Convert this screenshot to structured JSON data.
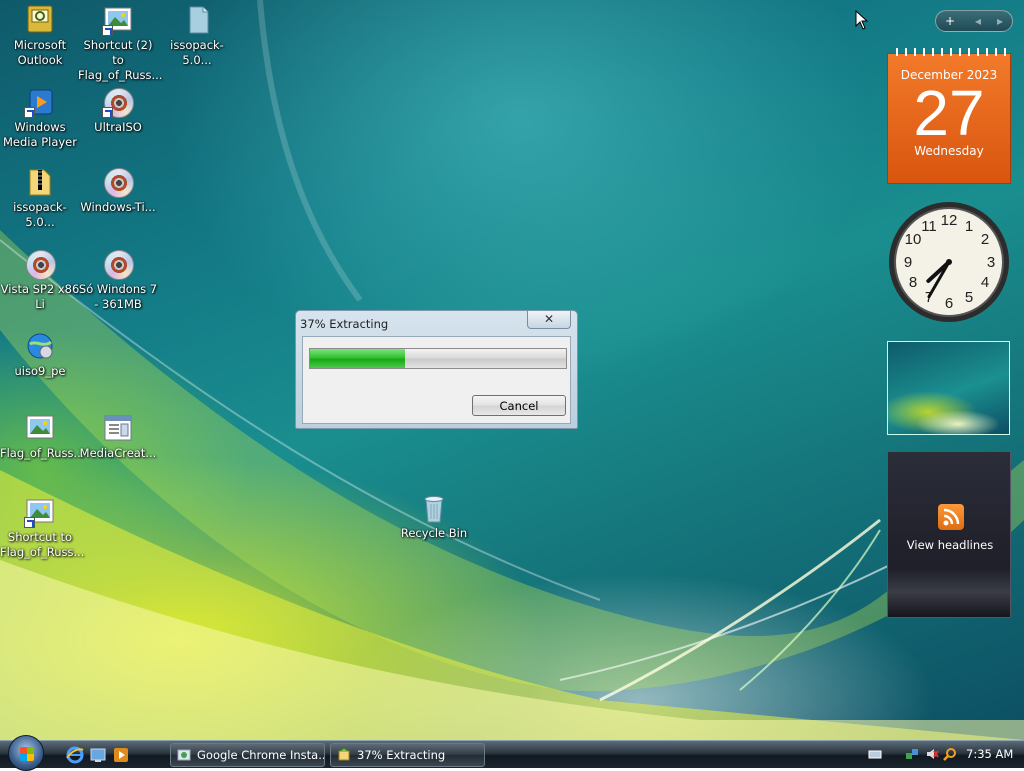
{
  "desktop": {
    "icons": [
      {
        "label": "Microsoft\nOutlook"
      },
      {
        "label": "Shortcut (2) to\nFlag_of_Russ..."
      },
      {
        "label": "issopack-5.0..."
      },
      {
        "label": "Windows\nMedia Player"
      },
      {
        "label": "UltraISO"
      },
      {
        "label": "issopack-5.0..."
      },
      {
        "label": "Windows-Ti..."
      },
      {
        "label": "Vista SP2 x86\nLi"
      },
      {
        "label": "Só Windons 7\n- 361MB"
      },
      {
        "label": "uiso9_pe"
      },
      {
        "label": "Flag_of_Russ..."
      },
      {
        "label": "MediaCreat..."
      },
      {
        "label": "Shortcut to\nFlag_of_Russ..."
      },
      {
        "label": "Recycle Bin"
      }
    ]
  },
  "sidebar": {
    "add_symbol": "+",
    "prev_symbol": "◂",
    "next_symbol": "▸",
    "calendar": {
      "month_year": "December 2023",
      "day": "27",
      "weekday": "Wednesday"
    },
    "clock": {
      "hour": 7,
      "minute": 35
    },
    "feeds": {
      "label": "View headlines"
    }
  },
  "dialog": {
    "title": "37% Extracting",
    "close_symbol": "✕",
    "progress_percent": 37,
    "cancel_label": "Cancel"
  },
  "taskbar": {
    "buttons": [
      {
        "label": "Google Chrome Insta..."
      },
      {
        "label": "37% Extracting"
      }
    ],
    "time": "7:35 AM"
  },
  "colors": {
    "calendar_orange": "#e8651a",
    "progress_green": "#22b022",
    "taskbar_dark": "#1c252e"
  }
}
